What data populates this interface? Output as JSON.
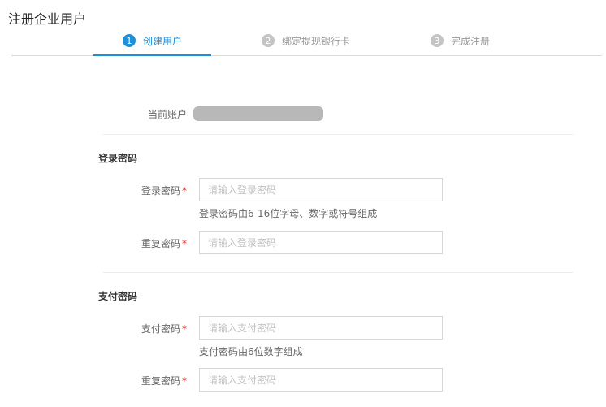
{
  "page": {
    "title": "注册企业用户"
  },
  "steps": [
    {
      "num": "1",
      "label": "创建用户",
      "active": true
    },
    {
      "num": "2",
      "label": "绑定提现银行卡",
      "active": false
    },
    {
      "num": "3",
      "label": "完成注册",
      "active": false
    }
  ],
  "account": {
    "label": "当前账户"
  },
  "login_section": {
    "title": "登录密码",
    "password": {
      "label": "登录密码",
      "required_mark": "*",
      "placeholder": "请输入登录密码",
      "hint": "登录密码由6-16位字母、数字或符号组成"
    },
    "repeat": {
      "label": "重复密码",
      "required_mark": "*",
      "placeholder": "请输入登录密码"
    }
  },
  "pay_section": {
    "title": "支付密码",
    "password": {
      "label": "支付密码",
      "required_mark": "*",
      "placeholder": "请输入支付密码",
      "hint": "支付密码由6位数字组成"
    },
    "repeat": {
      "label": "重复密码",
      "required_mark": "*",
      "placeholder": "请输入支付密码"
    }
  },
  "colors": {
    "accent": "#1e8fd9",
    "required": "#e2231a",
    "step_inactive": "#c4c4c4"
  }
}
